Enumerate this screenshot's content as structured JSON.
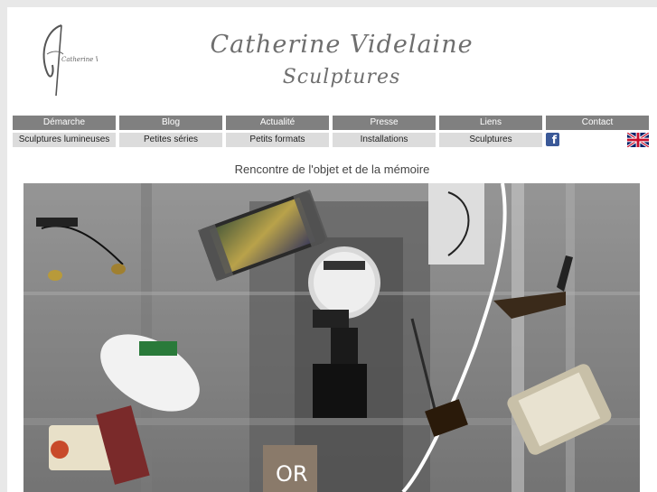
{
  "header": {
    "artist_name": "Catherine Videlaine",
    "subtitle": "Sculptures",
    "logo_text": "Catherine Videlaine"
  },
  "nav_primary": [
    {
      "label": "Démarche"
    },
    {
      "label": "Blog"
    },
    {
      "label": "Actualité"
    },
    {
      "label": "Presse"
    },
    {
      "label": "Liens"
    },
    {
      "label": "Contact"
    }
  ],
  "nav_secondary": [
    {
      "label": "Sculptures lumineuses"
    },
    {
      "label": "Petites séries"
    },
    {
      "label": "Petits formats"
    },
    {
      "label": "Installations"
    },
    {
      "label": "Sculptures"
    }
  ],
  "social": {
    "facebook_icon": "facebook-icon",
    "facebook_glyph": "f",
    "language_icon": "uk-flag-icon"
  },
  "main": {
    "caption": "Rencontre de l'objet et de la mémoire",
    "photo_sign_text": "OR"
  },
  "colors": {
    "nav_primary_bg": "#808080",
    "nav_secondary_bg": "#dcdcdc",
    "brand_text": "#6e6e6e",
    "page_bg": "#e8e8e8"
  }
}
